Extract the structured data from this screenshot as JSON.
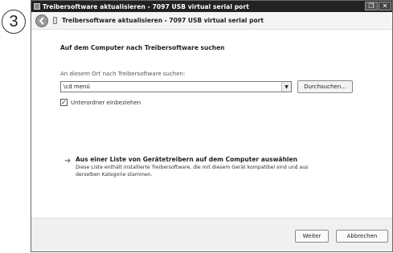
{
  "step": {
    "number": "3"
  },
  "window": {
    "title": "Treibersoftware aktualisieren - 7097 USB virtual serial port",
    "nav_title": "Treibersoftware aktualisieren - 7097 USB virtual serial port",
    "restore_glyph": "❐",
    "close_glyph": "✕"
  },
  "main": {
    "heading": "Auf dem Computer nach Treibersoftware suchen",
    "search_label": "An diesem Ort nach Treibersoftware suchen:",
    "path_value": "\\cd menü",
    "browse_label": "Durchsuchen...",
    "subfolder_label": "Unterordner einbeziehen",
    "subfolder_checked": true
  },
  "option": {
    "title": "Aus einer Liste von Gerätetreibern auf dem Computer auswählen",
    "description": "Diese Liste enthält installierte Treibersoftware, die mit diesem Gerät kompatibel sind und aus derselben Kategorie stammen."
  },
  "footer": {
    "next_label": "Weiter",
    "cancel_label": "Abbrechen"
  }
}
